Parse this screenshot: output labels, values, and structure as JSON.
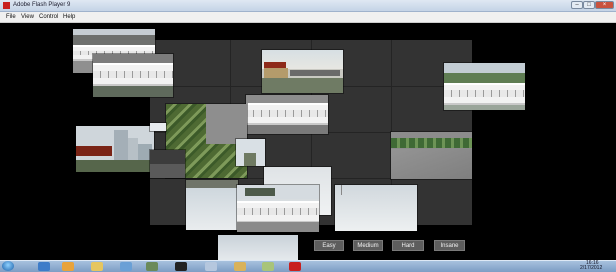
{
  "window": {
    "title": "Adobe Flash Player 9"
  },
  "menu": {
    "items": [
      "File",
      "View",
      "Control",
      "Help"
    ]
  },
  "game": {
    "difficulty_buttons": [
      "Easy",
      "Medium",
      "Hard",
      "Insane"
    ]
  },
  "taskbar": {
    "time": "16:16",
    "date": "2/17/2012"
  },
  "colors": {
    "board": "#333333",
    "button": "#5d5d5d",
    "titlebar": "#c4d3e6",
    "close_button": "#c9523e"
  }
}
